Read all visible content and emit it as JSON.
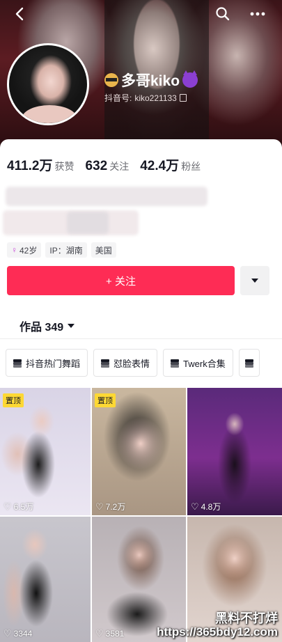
{
  "header": {
    "nickname": "多哥kiko",
    "handle_label": "抖音号:",
    "handle": "kiko221133"
  },
  "stats": [
    {
      "num": "411.2万",
      "label": "获赞"
    },
    {
      "num": "632",
      "label": "关注"
    },
    {
      "num": "42.4万",
      "label": "粉丝"
    }
  ],
  "tags": {
    "age": "42岁",
    "ip": "IP：湖南",
    "country": "美国"
  },
  "actions": {
    "follow": "+ 关注"
  },
  "works": {
    "label": "作品 349"
  },
  "collections": [
    "抖音热门舞蹈",
    "怼脸表情",
    "Twerk合集"
  ],
  "videos": [
    {
      "pinned": true,
      "pin_label": "置顶",
      "likes": "6.5万"
    },
    {
      "pinned": true,
      "pin_label": "置顶",
      "likes": "7.2万"
    },
    {
      "pinned": false,
      "likes": "4.8万"
    },
    {
      "pinned": false,
      "likes": "3344"
    },
    {
      "pinned": false,
      "likes": "3581"
    },
    {
      "pinned": false,
      "likes": "3277"
    }
  ],
  "watermark": {
    "line1": "黑料不打烊",
    "line2": "https://365bdy12.com"
  },
  "colors": {
    "accent": "#fe2c55",
    "pin": "#fdd834",
    "header_bg": "#3a1418"
  },
  "icons": {
    "back": "back-arrow-icon",
    "search": "search-icon",
    "more": "more-dots-icon"
  }
}
